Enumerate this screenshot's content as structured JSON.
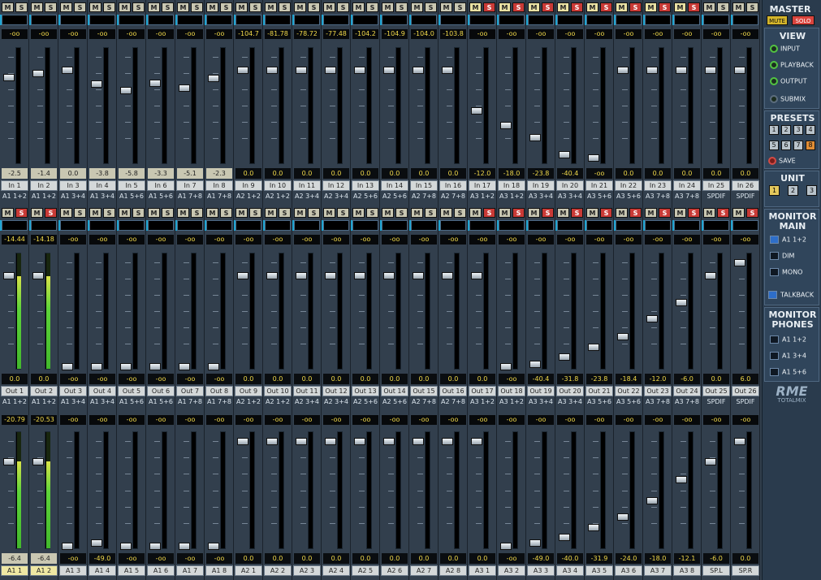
{
  "master": {
    "title": "MASTER",
    "mute": "MUTE",
    "solo": "SOLO"
  },
  "view": {
    "title": "VIEW",
    "items": [
      "INPUT",
      "PLAYBACK",
      "OUTPUT",
      "SUBMIX"
    ]
  },
  "presets": {
    "title": "PRESETS",
    "buttons": [
      "1",
      "2",
      "3",
      "4",
      "5",
      "6",
      "7",
      "8"
    ],
    "save": "SAVE",
    "active": "8"
  },
  "unit": {
    "title": "UNIT",
    "buttons": [
      "1",
      "2",
      "3"
    ],
    "active": "1"
  },
  "monitor_main": {
    "title1": "MONITOR",
    "title2": "MAIN",
    "route": "A1 1+2",
    "dim": "DIM",
    "mono": "MONO",
    "talkback": "TALKBACK"
  },
  "monitor_phones": {
    "title1": "MONITOR",
    "title2": "PHONES",
    "routes": [
      "A1 1+2",
      "A1 3+4",
      "A1 5+6"
    ]
  },
  "logo": {
    "brand": "RME",
    "product": "TOTALMIX"
  },
  "colors": {
    "accent": "#20a6d3",
    "solo": "#c93a36",
    "mute": "#e9e1a3",
    "meter": "#42b82d"
  },
  "row1": {
    "peaks": [
      "-oo",
      "-oo",
      "-oo",
      "-oo",
      "-oo",
      "-oo",
      "-oo",
      "-oo",
      "-104.7",
      "-81.78",
      "-78.72",
      "-77.48",
      "-104.2",
      "-104.9",
      "-104.0",
      "-103.8",
      "-oo",
      "-oo",
      "-oo",
      "-oo",
      "-oo",
      "-oo",
      "-oo",
      "-oo",
      "-oo",
      "-oo"
    ],
    "values": [
      "-2.5",
      "-1.4",
      "0.0",
      "-3.8",
      "-5.8",
      "-3.3",
      "-5.1",
      "-2.3",
      "0.0",
      "0.0",
      "0.0",
      "0.0",
      "0.0",
      "0.0",
      "0.0",
      "0.0",
      "-12.0",
      "-18.0",
      "-23.8",
      "-40.4",
      "-oo",
      "0.0",
      "0.0",
      "0.0",
      "0.0",
      "0.0"
    ],
    "labels": [
      "In 1",
      "In 2",
      "In 3",
      "In 4",
      "In 5",
      "In 6",
      "In 7",
      "In 8",
      "In 9",
      "In 10",
      "In 11",
      "In 12",
      "In 13",
      "In 14",
      "In 15",
      "In 16",
      "In 17",
      "In 18",
      "In 19",
      "In 20",
      "In 21",
      "In 22",
      "In 23",
      "In 24",
      "In 25",
      "In 26"
    ],
    "routes": [
      "A1 1+2",
      "A1 1+2",
      "A1 3+4",
      "A1 3+4",
      "A1 5+6",
      "A1 5+6",
      "A1 7+8",
      "A1 7+8",
      "A2 1+2",
      "A2 1+2",
      "A2 3+4",
      "A2 3+4",
      "A2 5+6",
      "A2 5+6",
      "A2 7+8",
      "A2 7+8",
      "A3 1+2",
      "A3 1+2",
      "A3 3+4",
      "A3 3+4",
      "A3 5+6",
      "A3 5+6",
      "A3 7+8",
      "A3 7+8",
      "SPDIF",
      "SPDIF"
    ],
    "levels": [
      0.78,
      0.82,
      0.85,
      0.72,
      0.66,
      0.73,
      0.68,
      0.77,
      0.85,
      0.85,
      0.85,
      0.85,
      0.85,
      0.85,
      0.85,
      0.85,
      0.47,
      0.33,
      0.22,
      0.06,
      0.03,
      0.85,
      0.85,
      0.85,
      0.85,
      0.85
    ],
    "meters": [
      0,
      0,
      0,
      0,
      0,
      0,
      0,
      0,
      0,
      0,
      0,
      0,
      0,
      0,
      0,
      0,
      0,
      0,
      0,
      0,
      0,
      0,
      0,
      0,
      0,
      0
    ],
    "solo": [
      false,
      false,
      false,
      false,
      false,
      false,
      false,
      false,
      false,
      false,
      false,
      false,
      false,
      false,
      false,
      false,
      true,
      true,
      true,
      true,
      true,
      true,
      true,
      true,
      false,
      false
    ],
    "mute": [
      false,
      false,
      false,
      false,
      false,
      false,
      false,
      false,
      false,
      false,
      false,
      false,
      false,
      false,
      false,
      false,
      true,
      true,
      true,
      true,
      true,
      true,
      true,
      true,
      false,
      false
    ],
    "highlight": [
      true,
      true,
      true,
      true,
      true,
      true,
      true,
      true,
      false,
      false,
      false,
      false,
      false,
      false,
      false,
      false,
      false,
      false,
      false,
      false,
      false,
      false,
      false,
      false,
      false,
      false
    ]
  },
  "row2": {
    "peaks": [
      "-14.44",
      "-14.18",
      "-oo",
      "-oo",
      "-oo",
      "-oo",
      "-oo",
      "-oo",
      "-oo",
      "-oo",
      "-oo",
      "-oo",
      "-oo",
      "-oo",
      "-oo",
      "-oo",
      "-oo",
      "-oo",
      "-oo",
      "-oo",
      "-oo",
      "-oo",
      "-oo",
      "-oo",
      "-oo",
      "-oo"
    ],
    "values": [
      "0.0",
      "0.0",
      "-oo",
      "-oo",
      "-oo",
      "-oo",
      "-oo",
      "-oo",
      "0.0",
      "0.0",
      "0.0",
      "0.0",
      "0.0",
      "0.0",
      "0.0",
      "0.0",
      "0.0",
      "-oo",
      "-40.4",
      "-31.8",
      "-23.8",
      "-18.4",
      "-12.0",
      "-6.0",
      "0.0",
      "6.0"
    ],
    "labels": [
      "Out 1",
      "Out 2",
      "Out 3",
      "Out 4",
      "Out 5",
      "Out 6",
      "Out 7",
      "Out 8",
      "Out 9",
      "Out 10",
      "Out 11",
      "Out 12",
      "Out 13",
      "Out 14",
      "Out 15",
      "Out 16",
      "Out 17",
      "Out 18",
      "Out 19",
      "Out 20",
      "Out 21",
      "Out 22",
      "Out 23",
      "Out 24",
      "Out 25",
      "Out 26"
    ],
    "routes": [
      "A1 1+2",
      "A1 1+2",
      "A1 3+4",
      "A1 3+4",
      "A1 5+6",
      "A1 5+6",
      "A1 7+8",
      "A1 7+8",
      "A2 1+2",
      "A2 1+2",
      "A2 3+4",
      "A2 3+4",
      "A2 5+6",
      "A2 5+6",
      "A2 7+8",
      "A2 7+8",
      "A3 1+2",
      "A3 1+2",
      "A3 3+4",
      "A3 3+4",
      "A3 5+6",
      "A3 5+6",
      "A3 7+8",
      "A3 7+8",
      "SPDIF",
      "SPDIF"
    ],
    "levels": [
      0.85,
      0.85,
      0,
      0,
      0,
      0,
      0,
      0,
      0.85,
      0.85,
      0.85,
      0.85,
      0.85,
      0.85,
      0.85,
      0.85,
      0.85,
      0,
      0.02,
      0.09,
      0.18,
      0.28,
      0.45,
      0.6,
      0.85,
      0.97
    ],
    "meters": [
      0.8,
      0.8,
      0,
      0,
      0,
      0,
      0,
      0,
      0,
      0,
      0,
      0,
      0,
      0,
      0,
      0,
      0,
      0,
      0,
      0,
      0,
      0,
      0,
      0,
      0,
      0
    ],
    "solo": [
      true,
      true,
      false,
      false,
      false,
      false,
      false,
      false,
      false,
      false,
      false,
      false,
      false,
      false,
      false,
      false,
      true,
      true,
      true,
      true,
      true,
      true,
      true,
      true,
      true,
      true
    ],
    "mute": [
      false,
      false,
      false,
      false,
      false,
      false,
      false,
      false,
      false,
      false,
      false,
      false,
      false,
      false,
      false,
      false,
      false,
      false,
      false,
      false,
      false,
      false,
      false,
      false,
      false,
      false
    ],
    "highlight": [
      false,
      false,
      false,
      false,
      false,
      false,
      false,
      false,
      false,
      false,
      false,
      false,
      false,
      false,
      false,
      false,
      false,
      false,
      false,
      false,
      false,
      false,
      false,
      false,
      false,
      false
    ]
  },
  "row3": {
    "peaks": [
      "-20.79",
      "-20.53",
      "-oo",
      "-oo",
      "-oo",
      "-oo",
      "-oo",
      "-oo",
      "-oo",
      "-oo",
      "-oo",
      "-oo",
      "-oo",
      "-oo",
      "-oo",
      "-oo",
      "-oo",
      "-oo",
      "-oo",
      "-oo",
      "-oo",
      "-oo",
      "-oo",
      "-oo",
      "-oo",
      "-oo"
    ],
    "values": [
      "-6.4",
      "-6.4",
      "-oo",
      "-49.0",
      "-oo",
      "-oo",
      "-oo",
      "-oo",
      "0.0",
      "0.0",
      "0.0",
      "0.0",
      "0.0",
      "0.0",
      "0.0",
      "0.0",
      "0.0",
      "-oo",
      "-49.0",
      "-40.0",
      "-31.9",
      "-24.0",
      "-18.0",
      "-12.1",
      "-6.0",
      "0.0"
    ],
    "labels": [
      "A1 1",
      "A1 2",
      "A1 3",
      "A1 4",
      "A1 5",
      "A1 6",
      "A1 7",
      "A1 8",
      "A2 1",
      "A2 2",
      "A2 3",
      "A2 4",
      "A2 5",
      "A2 6",
      "A2 7",
      "A2 8",
      "A3 1",
      "A3 2",
      "A3 3",
      "A3 4",
      "A3 5",
      "A3 6",
      "A3 7",
      "A3 8",
      "SP.L",
      "SP.R"
    ],
    "levels": [
      0.78,
      0.78,
      0,
      0.03,
      0,
      0,
      0,
      0,
      0.97,
      0.97,
      0.97,
      0.97,
      0.97,
      0.97,
      0.97,
      0.97,
      0.97,
      0,
      0.03,
      0.08,
      0.17,
      0.27,
      0.42,
      0.62,
      0.78,
      0.97
    ],
    "meters": [
      0.75,
      0.75,
      0,
      0,
      0,
      0,
      0,
      0,
      0,
      0,
      0,
      0,
      0,
      0,
      0,
      0,
      0,
      0,
      0,
      0,
      0,
      0,
      0,
      0,
      0,
      0
    ],
    "highlight": [
      true,
      true,
      false,
      false,
      false,
      false,
      false,
      false,
      false,
      false,
      false,
      false,
      false,
      false,
      false,
      false,
      false,
      false,
      false,
      false,
      false,
      false,
      false,
      false,
      false,
      false
    ]
  }
}
